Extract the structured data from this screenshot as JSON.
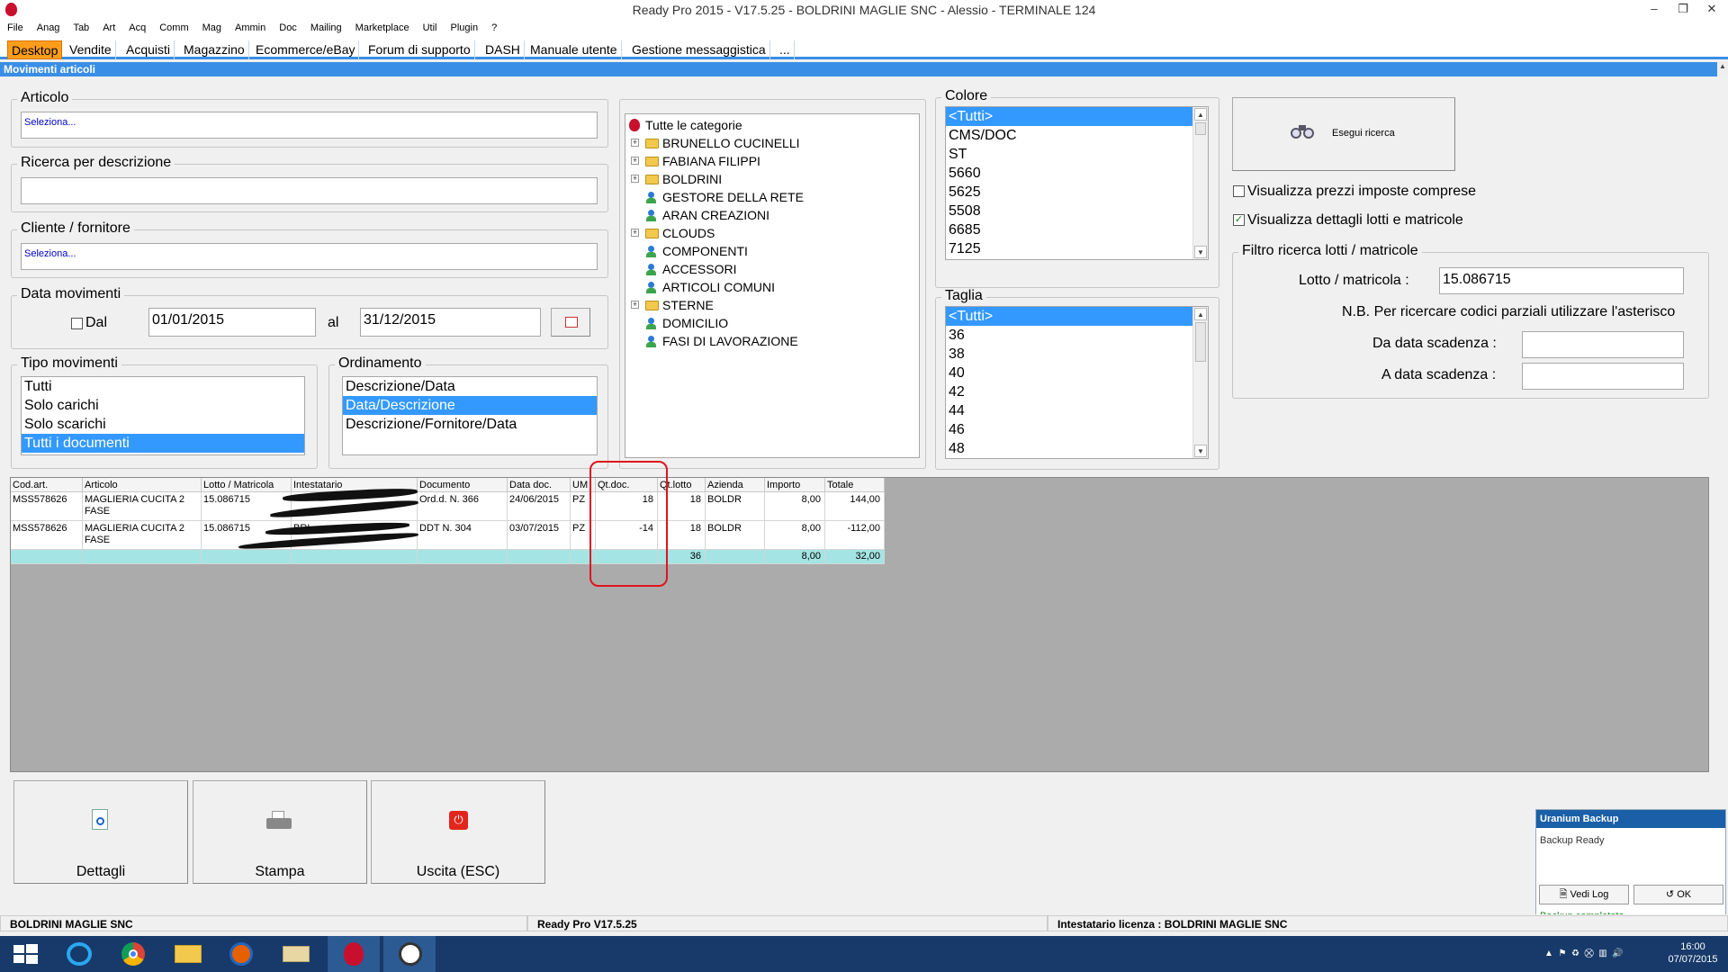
{
  "window": {
    "title": "Ready Pro 2015 - V17.5.25 - BOLDRINI MAGLIE SNC - Alessio - TERMINALE 124"
  },
  "menu": [
    "File",
    "Anag",
    "Tab",
    "Art",
    "Acq",
    "Comm",
    "Mag",
    "Ammin",
    "Doc",
    "Mailing",
    "Marketplace",
    "Util",
    "Plugin",
    "?"
  ],
  "tabs": [
    "Desktop",
    "Vendite",
    "Acquisti",
    "Magazzino",
    "Ecommerce/eBay",
    "Forum di supporto",
    "DASH",
    "Manuale utente",
    "Gestione messaggistica",
    "..."
  ],
  "caption": "Movimenti articoli",
  "articolo": {
    "label": "Articolo",
    "value": "Seleziona..."
  },
  "ricerca": {
    "label": "Ricerca per descrizione",
    "value": ""
  },
  "cliente": {
    "label": "Cliente / fornitore",
    "value": "Seleziona..."
  },
  "data_mov": {
    "label": "Data movimenti",
    "dal_label": "Dal",
    "dal": "01/01/2015",
    "al_label": "al",
    "al": "31/12/2015"
  },
  "tipo_mov": {
    "label": "Tipo movimenti",
    "items": [
      "Tutti",
      "Solo carichi",
      "Solo scarichi",
      "Tutti i documenti"
    ],
    "selected": "Tutti i documenti"
  },
  "ordinamento": {
    "label": "Ordinamento",
    "items": [
      "Descrizione/Data",
      "Data/Descrizione",
      "Descrizione/Fornitore/Data"
    ],
    "selected": "Data/Descrizione"
  },
  "categorie": {
    "root": "Tutte le categorie",
    "items": [
      {
        "label": "BRUNELLO CUCINELLI",
        "type": "folder",
        "expandable": true
      },
      {
        "label": "FABIANA FILIPPI",
        "type": "folder",
        "expandable": true
      },
      {
        "label": "BOLDRINI",
        "type": "folder",
        "expandable": true
      },
      {
        "label": "GESTORE DELLA RETE",
        "type": "person",
        "expandable": false
      },
      {
        "label": "ARAN CREAZIONI",
        "type": "person",
        "expandable": false
      },
      {
        "label": "CLOUDS",
        "type": "folder",
        "expandable": true
      },
      {
        "label": "COMPONENTI",
        "type": "person",
        "expandable": false
      },
      {
        "label": "ACCESSORI",
        "type": "person",
        "expandable": false
      },
      {
        "label": "ARTICOLI COMUNI",
        "type": "person",
        "expandable": false
      },
      {
        "label": "STERNE",
        "type": "folder",
        "expandable": true
      },
      {
        "label": "DOMICILIO",
        "type": "person",
        "expandable": false
      },
      {
        "label": "FASI DI LAVORAZIONE",
        "type": "person",
        "expandable": false
      }
    ]
  },
  "colore": {
    "label": "Colore",
    "items": [
      "<Tutti>",
      "CMS/DOC",
      "ST",
      "5660",
      "5625",
      "5508",
      "6685",
      "7125"
    ],
    "selected": "<Tutti>"
  },
  "taglia": {
    "label": "Taglia",
    "items": [
      "<Tutti>",
      "36",
      "38",
      "40",
      "42",
      "44",
      "46",
      "48"
    ],
    "selected": "<Tutti>"
  },
  "esegui": {
    "label": "Esegui ricerca"
  },
  "opzioni": {
    "prezzi": {
      "label": "Visualizza prezzi imposte comprese",
      "checked": false
    },
    "lotti": {
      "label": "Visualizza dettagli lotti e matricole",
      "checked": true
    }
  },
  "filtro": {
    "label": "Filtro ricerca lotti / matricole",
    "lotto_label": "Lotto / matricola :",
    "lotto": "15.086715",
    "nb": "N.B. Per ricercare codici parziali utilizzare l'asterisco",
    "da_label": "Da data scadenza :",
    "a_label": "A data scadenza :"
  },
  "grid": {
    "headers": [
      "Cod.art.",
      "Articolo",
      "Lotto / Matricola",
      "Intestatario",
      "Documento",
      "Data doc.",
      "UM",
      "Qt.doc.",
      "Qt.lotto",
      "Azienda",
      "Importo",
      "Totale"
    ],
    "rows": [
      {
        "cod": "MSS578626",
        "articolo": "MAGLIERIA CUCITA  2 FASE",
        "lotto": "15.086715",
        "intestatario": "",
        "documento": "Ord.d. N. 366",
        "data": "24/06/2015",
        "um": "PZ",
        "qtdoc": "18",
        "qtlotto": "18",
        "azienda": "BOLDR",
        "importo": "8,00",
        "totale": "144,00"
      },
      {
        "cod": "MSS578626",
        "articolo": "MAGLIERIA CUCITA  2 FASE",
        "lotto": "15.086715",
        "intestatario": "BRI",
        "documento": "DDT N. 304",
        "data": "03/07/2015",
        "um": "PZ",
        "qtdoc": "-14",
        "qtlotto": "18",
        "azienda": "BOLDR",
        "importo": "8,00",
        "totale": "-112,00"
      }
    ],
    "totals": {
      "qtlotto": "36",
      "importo": "8,00",
      "totale": "32,00"
    }
  },
  "buttons": {
    "dettagli": "Dettagli",
    "stampa": "Stampa",
    "uscita": "Uscita (ESC)"
  },
  "status": {
    "left": "BOLDRINI MAGLIE SNC",
    "mid": "Ready Pro V17.5.25",
    "right": "Intestatario licenza : BOLDRINI MAGLIE SNC"
  },
  "popup": {
    "title": "Uranium Backup",
    "state": "Backup Ready",
    "vedi": "Vedi Log",
    "ok": "OK",
    "done": "Backup completato"
  },
  "clock": {
    "time": "16:00",
    "date": "07/07/2015"
  },
  "colors": {
    "accent": "#3a8ee6",
    "tab_active": "#ff9d1a",
    "selection": "#3399ff",
    "total_row": "#a4e4e4",
    "highlight": "#e0141e"
  }
}
